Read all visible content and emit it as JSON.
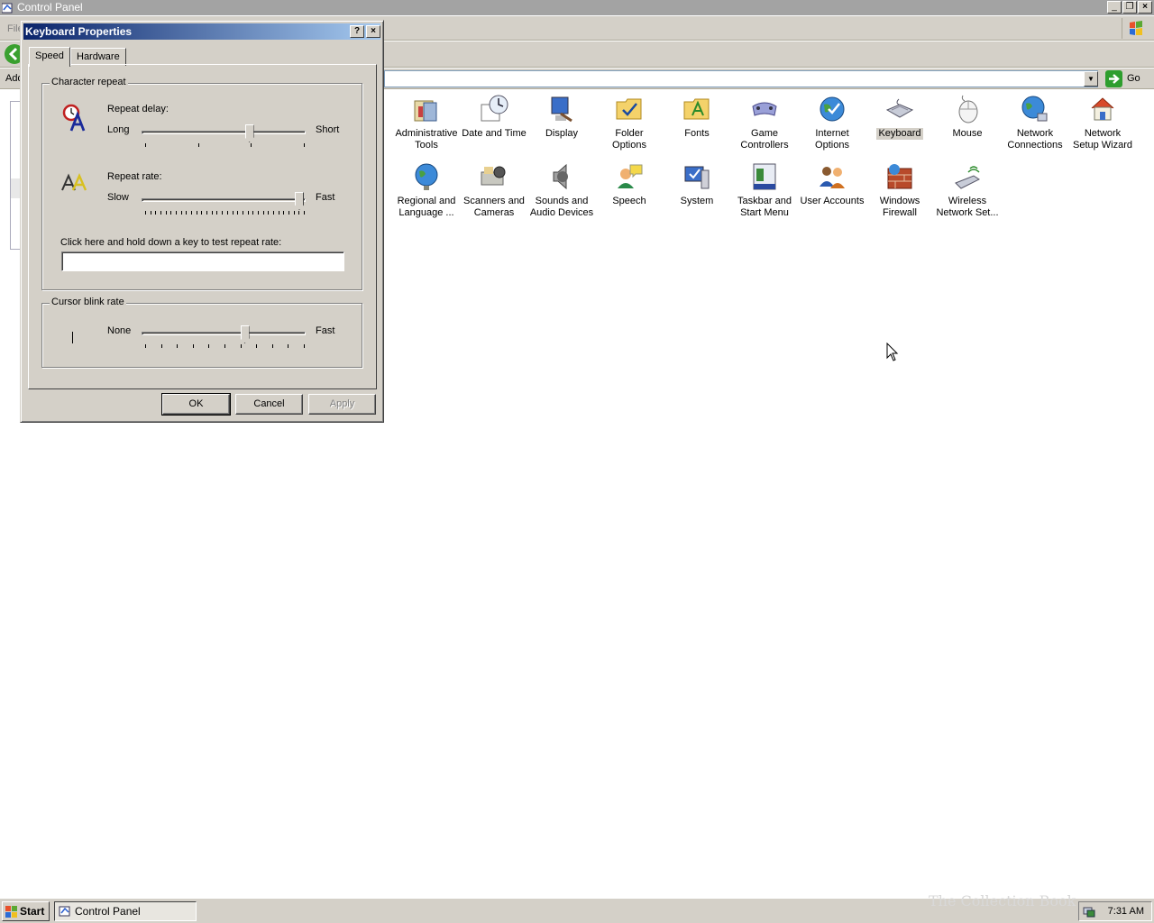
{
  "window": {
    "title": "Control Panel",
    "menu_file": "File",
    "address_label": "Address",
    "go_label": "Go"
  },
  "items": [
    {
      "label": "Administrative Tools",
      "icon": "admin-tools-icon"
    },
    {
      "label": "Date and Time",
      "icon": "date-time-icon"
    },
    {
      "label": "Display",
      "icon": "display-icon"
    },
    {
      "label": "Folder Options",
      "icon": "folder-options-icon"
    },
    {
      "label": "Fonts",
      "icon": "fonts-icon"
    },
    {
      "label": "Game Controllers",
      "icon": "game-controllers-icon"
    },
    {
      "label": "Internet Options",
      "icon": "internet-options-icon"
    },
    {
      "label": "Keyboard",
      "icon": "keyboard-icon",
      "selected": true
    },
    {
      "label": "Mouse",
      "icon": "mouse-icon"
    },
    {
      "label": "Network Connections",
      "icon": "network-connections-icon"
    },
    {
      "label": "Network Setup Wizard",
      "icon": "network-setup-icon"
    },
    {
      "label": "Regional and Language ...",
      "icon": "regional-icon"
    },
    {
      "label": "Scanners and Cameras",
      "icon": "scanners-icon"
    },
    {
      "label": "Sounds and Audio Devices",
      "icon": "sounds-icon"
    },
    {
      "label": "Speech",
      "icon": "speech-icon"
    },
    {
      "label": "System",
      "icon": "system-icon"
    },
    {
      "label": "Taskbar and Start Menu",
      "icon": "taskbar-icon"
    },
    {
      "label": "User Accounts",
      "icon": "user-accounts-icon"
    },
    {
      "label": "Windows Firewall",
      "icon": "firewall-icon"
    },
    {
      "label": "Wireless Network Set...",
      "icon": "wireless-icon"
    }
  ],
  "dialog": {
    "title": "Keyboard Properties",
    "help": "?",
    "close": "×",
    "tabs": [
      "Speed",
      "Hardware"
    ],
    "char_repeat": {
      "title": "Character repeat",
      "delay_label": "Repeat delay:",
      "delay_min": "Long",
      "delay_max": "Short",
      "delay_value": 0.67,
      "rate_label": "Repeat rate:",
      "rate_min": "Slow",
      "rate_max": "Fast",
      "rate_value": 1.0,
      "test_label": "Click here and hold down a key to test repeat rate:",
      "test_value": ""
    },
    "cursor_blink": {
      "title": "Cursor blink rate",
      "min": "None",
      "max": "Fast",
      "value": 0.64
    },
    "buttons": {
      "ok": "OK",
      "cancel": "Cancel",
      "apply": "Apply"
    }
  },
  "taskbar": {
    "start": "Start",
    "task": "Control Panel",
    "clock": "7:31 AM"
  },
  "watermark": "The Collection Book"
}
